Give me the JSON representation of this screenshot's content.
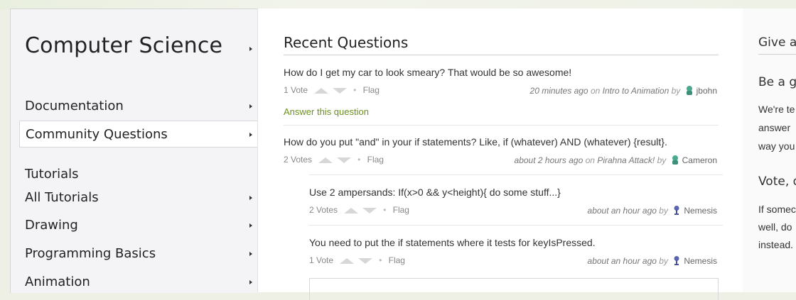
{
  "sidebar": {
    "topic_title": "Computer Science",
    "items": [
      {
        "label": "Documentation"
      },
      {
        "label": "Community Questions"
      }
    ],
    "section_heading": "Tutorials",
    "tutorials": [
      {
        "label": "All Tutorials"
      },
      {
        "label": "Drawing"
      },
      {
        "label": "Programming Basics"
      },
      {
        "label": "Animation"
      }
    ]
  },
  "main": {
    "title": "Recent Questions",
    "questions": [
      {
        "text": "How do I get my car to look smeary? That would be so awesome!",
        "votes": "1 Vote",
        "flag": "Flag",
        "time": "20 minutes ago",
        "on": "on",
        "program": "Intro to Animation",
        "by": "by",
        "user": "jbohn",
        "answer_link": "Answer this question"
      },
      {
        "text": "How do you put \"and\" in your if statements? Like, if (whatever) AND (whatever) {result}.",
        "votes": "2 Votes",
        "flag": "Flag",
        "time": "about 2 hours ago",
        "on": "on",
        "program": "Pirahna Attack!",
        "by": "by",
        "user": "Cameron"
      }
    ],
    "answers": [
      {
        "text": "Use 2 ampersands: If(x>0 && y<height){ do some stuff...}",
        "votes": "2 Votes",
        "flag": "Flag",
        "time": "about an hour ago",
        "by": "by",
        "user": "Nemesis"
      },
      {
        "text": "You need to put the if statements where it tests for keyIsPressed.",
        "votes": "1 Vote",
        "flag": "Flag",
        "time": "about an hour ago",
        "by": "by",
        "user": "Nemesis"
      }
    ]
  },
  "right_panel": {
    "heading": "Give a",
    "subheading": "Be a gu",
    "para1": [
      "We're te",
      "answer",
      "way you"
    ],
    "subheading2": "Vote, d",
    "para2": [
      "If somec",
      "well, do",
      "instead."
    ]
  },
  "colors": {
    "accent_green": "#6b8f1e",
    "sidebar_bg": "#f4f3f6"
  }
}
